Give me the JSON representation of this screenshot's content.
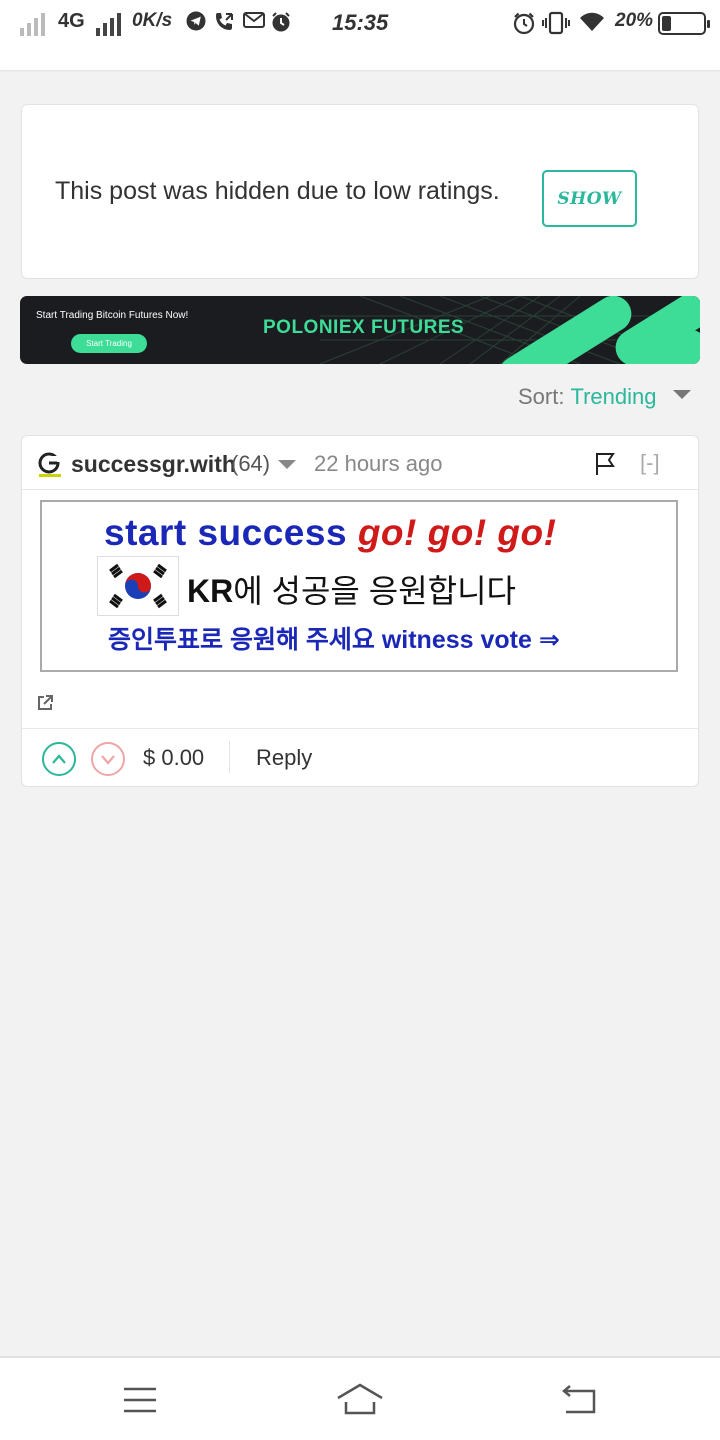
{
  "status_bar": {
    "network": "4G",
    "speed": "0K/s",
    "time": "15:35",
    "battery": "20%",
    "icons": [
      "signal-icon",
      "telegram-icon",
      "phone-icon",
      "gmail-icon",
      "alarm-icon",
      "vibrate-icon",
      "wifi-icon",
      "battery-icon"
    ]
  },
  "hidden_post": {
    "message": "This post was hidden due to low ratings.",
    "show_label": "SHOW"
  },
  "ad_banner": {
    "cta_text": "Start Trading Bitcoin Futures Now!",
    "button_label": "Start Trading",
    "brand": "POLONIEX FUTURES",
    "accent_color": "#3ddc97"
  },
  "sort": {
    "label": "Sort:",
    "value": "Trending"
  },
  "comment": {
    "author": "successgr.with",
    "reputation": "(64)",
    "time_ago": "22 hours ago",
    "collapse_label": "[-]",
    "image": {
      "line1_a": "start success ",
      "line1_b": "go! go! go!",
      "line2_bold": "KR",
      "line2_rest": "에 성공을 응원합니다",
      "line3": "증인투표로 응원해 주세요 witness vote ⇒"
    },
    "payout": "$ 0.00",
    "reply_label": "Reply"
  },
  "colors": {
    "accent": "#2bb79b",
    "downvote": "#f0a6a6"
  }
}
